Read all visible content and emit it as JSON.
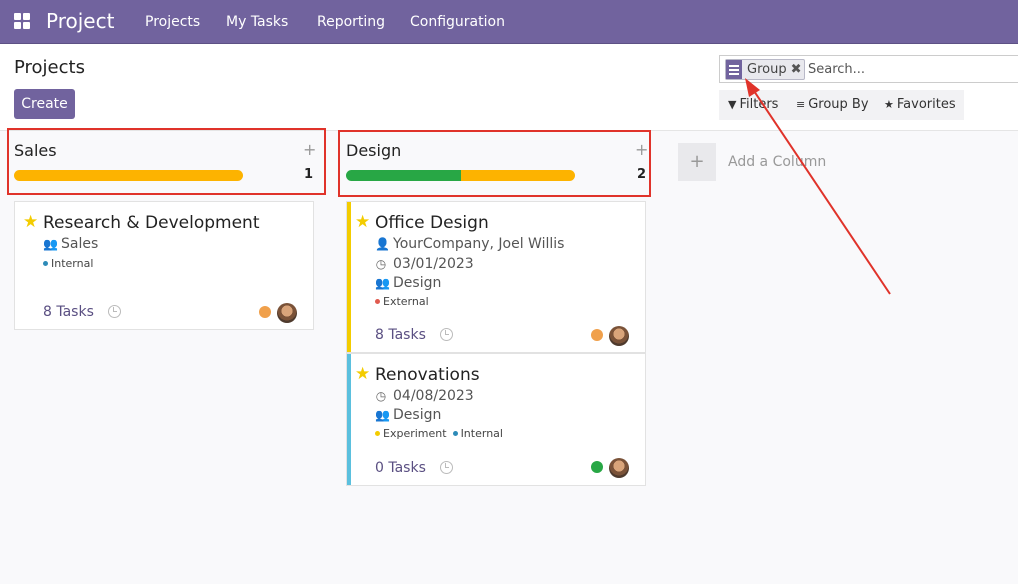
{
  "topbar": {
    "app_title": "Project",
    "nav": [
      "Projects",
      "My Tasks",
      "Reporting",
      "Configuration"
    ]
  },
  "control": {
    "breadcrumb": "Projects",
    "create_label": "Create",
    "search": {
      "facet_label": "Group",
      "facet_close": "✖",
      "placeholder": "Search..."
    },
    "filters_label": "Filters",
    "group_by_label": "Group By",
    "favorites_label": "Favorites"
  },
  "columns": [
    {
      "title": "Sales",
      "count": "1",
      "progress": {
        "done": 0,
        "warning": 1.0
      }
    },
    {
      "title": "Design",
      "count": "2",
      "progress": {
        "done": 0.5,
        "warning": 0.5
      }
    }
  ],
  "cards": [
    {
      "title": "Research & Development",
      "team": "Sales",
      "tags": [
        "Internal"
      ],
      "tasks": "8 Tasks",
      "status_color": "#f0a04b"
    },
    {
      "title": "Office Design",
      "customer": "YourCompany, Joel Willis",
      "date": "03/01/2023",
      "team": "Design",
      "tags": [
        "External"
      ],
      "tasks": "8 Tasks",
      "status_color": "#f0a04b"
    },
    {
      "title": "Renovations",
      "date": "04/08/2023",
      "team": "Design",
      "tags": [
        "Experiment",
        "Internal"
      ],
      "tasks": "0 Tasks",
      "status_color": "#28a745"
    }
  ],
  "add_column_label": "Add a Column",
  "colors": {
    "brand": "#71639e",
    "progress_green": "#28a745",
    "progress_orange": "#fdb300",
    "annotation_red": "#e0332a"
  }
}
